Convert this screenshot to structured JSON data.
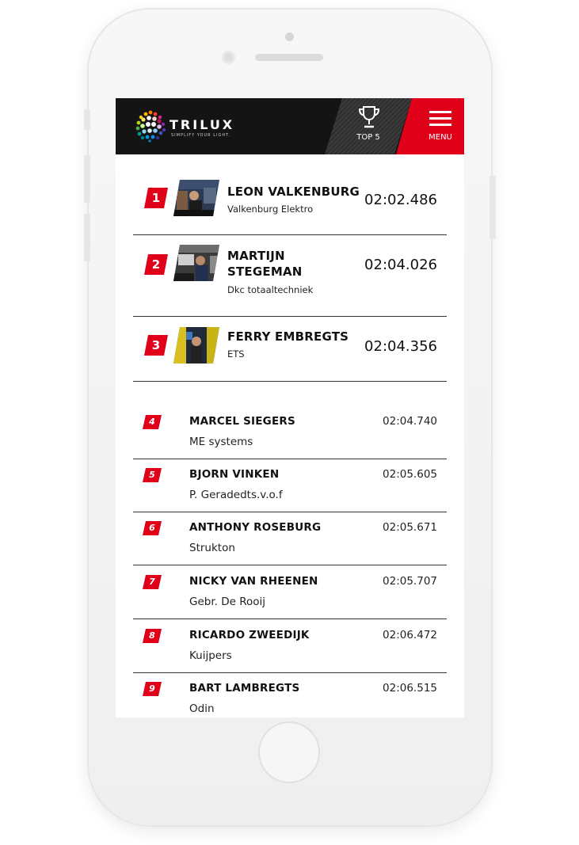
{
  "header": {
    "logo_text": "TRILUX",
    "logo_tagline": "SIMPLIFY YOUR LIGHT.",
    "top5_label": "TOP 5",
    "menu_label": "MENU"
  },
  "colors": {
    "accent": "#e1001a",
    "header_bg": "#141414"
  },
  "top_three": [
    {
      "rank": "1",
      "name": "LEON VALKENBURG",
      "company": "Valkenburg Elektro",
      "time": "02:02.486"
    },
    {
      "rank": "2",
      "name": "MARTIJN STEGEMAN",
      "company": "Dkc totaaltechniek",
      "time": "02:04.026"
    },
    {
      "rank": "3",
      "name": "FERRY EMBREGTS",
      "company": "ETS",
      "time": "02:04.356"
    }
  ],
  "ranking": [
    {
      "rank": "4",
      "name": "MARCEL SIEGERS",
      "company": "ME systems",
      "time": "02:04.740"
    },
    {
      "rank": "5",
      "name": "BJORN VINKEN",
      "company": "P. Geradedts.v.o.f",
      "time": "02:05.605"
    },
    {
      "rank": "6",
      "name": "ANTHONY ROSEBURG",
      "company": "Strukton",
      "time": "02:05.671"
    },
    {
      "rank": "7",
      "name": "NICKY VAN RHEENEN",
      "company": "Gebr. De Rooij",
      "time": "02:05.707"
    },
    {
      "rank": "8",
      "name": "RICARDO ZWEEDIJK",
      "company": "Kuijpers",
      "time": "02:06.472"
    },
    {
      "rank": "9",
      "name": "BART LAMBREGTS",
      "company": "Odin",
      "time": "02:06.515"
    }
  ]
}
